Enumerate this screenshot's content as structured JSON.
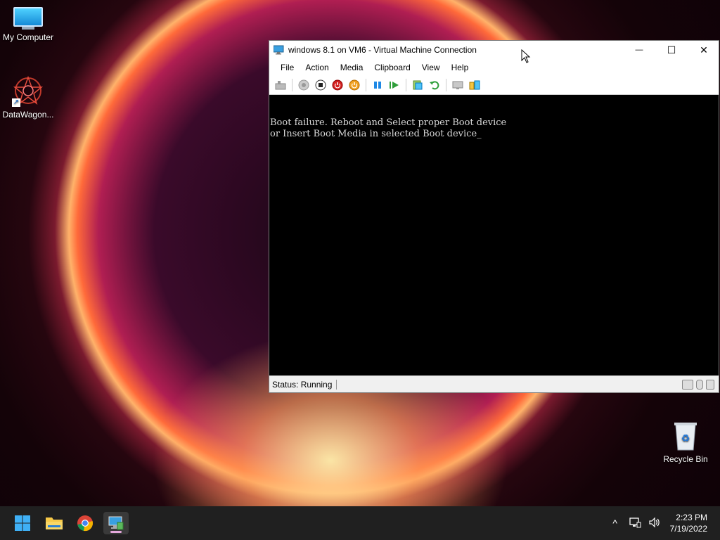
{
  "desktop": {
    "icons": [
      {
        "label": "My Computer"
      },
      {
        "label": "DataWagon..."
      },
      {
        "label": "Recycle Bin"
      }
    ]
  },
  "window": {
    "title": "windows 8.1 on VM6 - Virtual Machine Connection",
    "controls": {
      "minimize": "—",
      "maximize": "☐",
      "close": "✕"
    },
    "menu": [
      "File",
      "Action",
      "Media",
      "Clipboard",
      "View",
      "Help"
    ],
    "toolbar": [
      "ctrl-alt-del-icon",
      "start-icon",
      "turn-off-icon",
      "shut-down-icon",
      "save-icon",
      "pause-icon",
      "resume-icon",
      "checkpoint-icon",
      "revert-icon",
      "enhanced-session-icon",
      "share-icon"
    ],
    "console_lines": [
      "Boot failure. Reboot and Select proper Boot device",
      "or Insert Boot Media in selected Boot device_"
    ],
    "status": "Status: Running"
  },
  "taskbar": {
    "apps": [
      "start-button",
      "file-explorer",
      "chrome",
      "hyper-v-vm-connection"
    ],
    "time": "2:23 PM",
    "date": "7/19/2022",
    "tray": {
      "chevron": "^"
    }
  }
}
